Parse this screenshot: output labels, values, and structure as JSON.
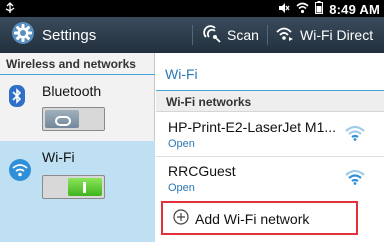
{
  "status_bar": {
    "time": "8:49 AM"
  },
  "action_bar": {
    "title": "Settings",
    "scan_label": "Scan",
    "wifi_direct_label": "Wi-Fi Direct"
  },
  "sidebar": {
    "section_header": "Wireless and networks",
    "items": [
      {
        "label": "Bluetooth",
        "toggle": "off",
        "selected": false
      },
      {
        "label": "Wi-Fi",
        "toggle": "on",
        "selected": true
      }
    ]
  },
  "detail": {
    "title": "Wi-Fi",
    "subheader": "Wi-Fi networks",
    "networks": [
      {
        "name": "HP-Print-E2-LaserJet M1...",
        "security": "Open"
      },
      {
        "name": "RRCGuest",
        "security": "Open"
      }
    ],
    "add_network_label": "Add Wi-Fi network"
  },
  "colors": {
    "accent_blue": "#2b79b6",
    "selected_row": "#bfe0f3",
    "toggle_on": "#3fb51c",
    "highlight_red": "#e3313b"
  }
}
